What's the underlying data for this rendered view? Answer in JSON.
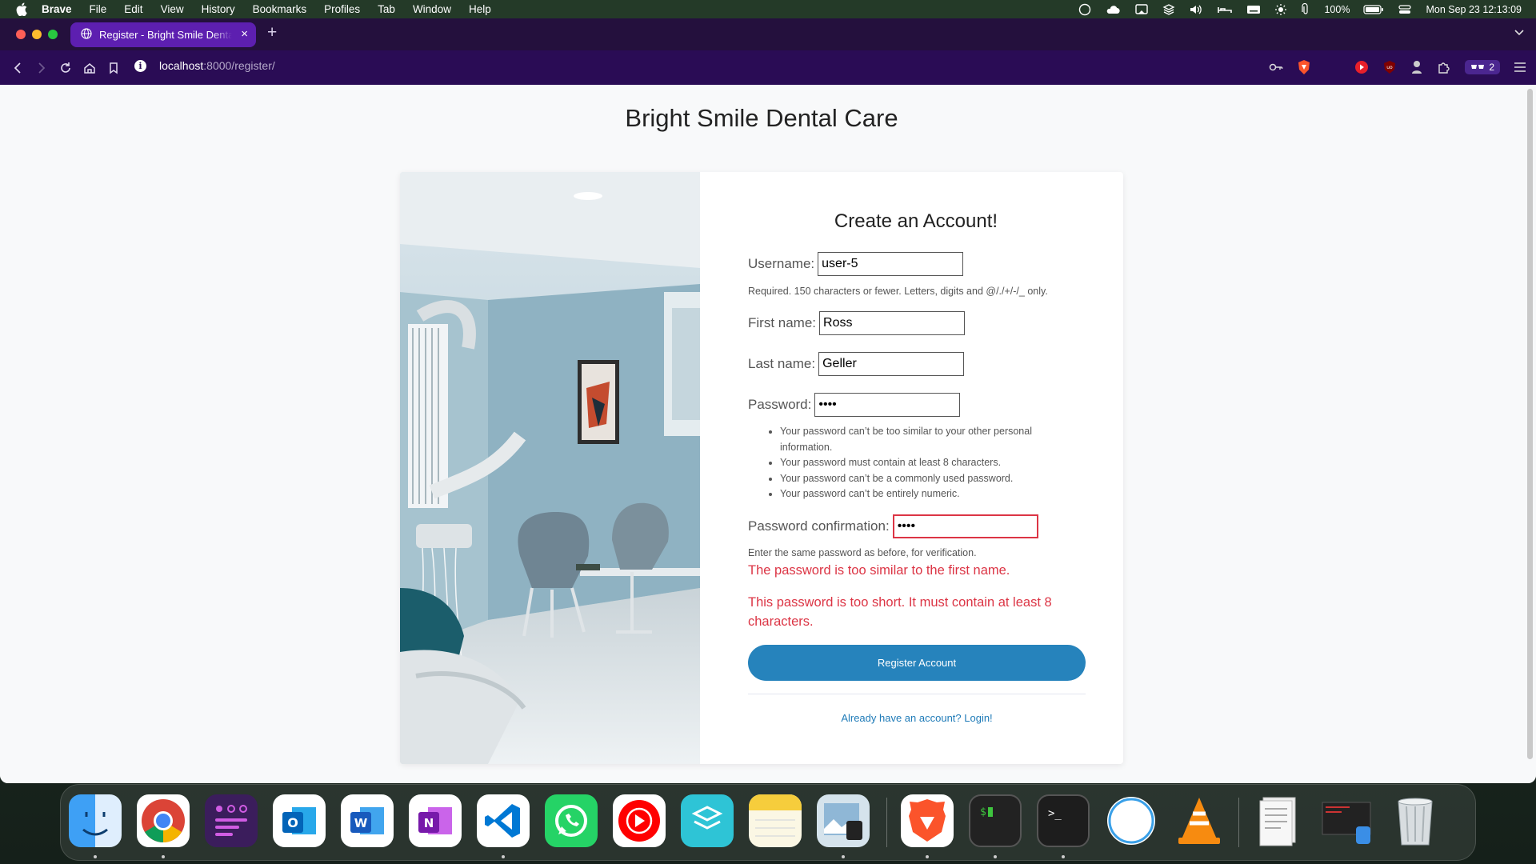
{
  "menubar": {
    "app": "Brave",
    "items": [
      "File",
      "Edit",
      "View",
      "History",
      "Bookmarks",
      "Profiles",
      "Tab",
      "Window",
      "Help"
    ],
    "battery": "100%",
    "datetime": "Mon Sep 23  12:13:09"
  },
  "tab": {
    "title": "Register - Bright Smile Dental Care"
  },
  "address": {
    "host": "localhost",
    "path": ":8000/register/"
  },
  "toolbar": {
    "wallet_count": "2"
  },
  "page": {
    "heading": "Bright Smile Dental Care",
    "form_title": "Create an Account!",
    "username_label": "Username:",
    "username_value": "user-5",
    "username_help": "Required. 150 characters or fewer. Letters, digits and @/./+/-/_ only.",
    "first_name_label": "First name:",
    "first_name_value": "Ross",
    "last_name_label": "Last name:",
    "last_name_value": "Geller",
    "password_label": "Password:",
    "password_value": "••••",
    "password_help": [
      "Your password can’t be too similar to your other personal information.",
      "Your password must contain at least 8 characters.",
      "Your password can’t be a commonly used password.",
      "Your password can’t be entirely numeric."
    ],
    "confirm_label": "Password confirmation:",
    "confirm_value": "••••",
    "confirm_help": "Enter the same password as before, for verification.",
    "errors": [
      "The password is too similar to the first name.",
      "This password is too short. It must contain at least 8 characters."
    ],
    "submit_label": "Register Account",
    "login_link": "Already have an account? Login!"
  },
  "colors": {
    "primary_button": "#2683bc",
    "error": "#dc3545",
    "link": "#1f7bb8",
    "tab_bar": "#24103d",
    "toolbar": "#2a0c55",
    "active_tab": "#5d1fb0"
  },
  "dock": [
    "finder-icon",
    "chrome-icon",
    "tasks-icon",
    "outlook-icon",
    "word-icon",
    "onenote-icon",
    "vscode-icon",
    "whatsapp-icon",
    "youtube-music-icon",
    "layers-icon",
    "notes-icon",
    "preview-icon",
    "brave-icon",
    "terminal-icon",
    "terminal-prompt-icon",
    "circle-app-icon",
    "vlc-icon",
    "document-stack-icon",
    "screen-recorder-icon",
    "trash-icon"
  ]
}
